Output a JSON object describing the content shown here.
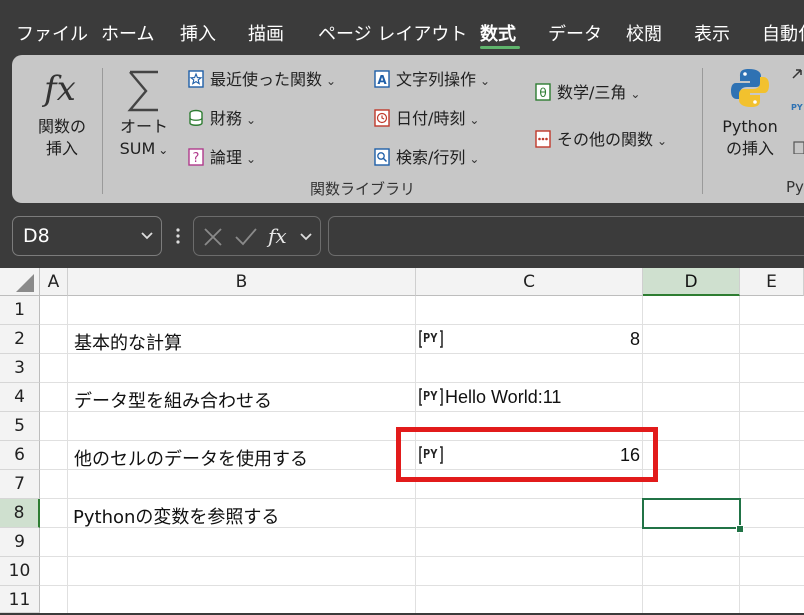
{
  "menubar": {
    "tabs": [
      {
        "label": "ファイル",
        "active": false
      },
      {
        "label": "ホーム",
        "active": false
      },
      {
        "label": "挿入",
        "active": false
      },
      {
        "label": "描画",
        "active": false
      },
      {
        "label": "ページ レイアウト",
        "active": false
      },
      {
        "label": "数式",
        "active": true
      },
      {
        "label": "データ",
        "active": false
      },
      {
        "label": "校閲",
        "active": false
      },
      {
        "label": "表示",
        "active": false
      },
      {
        "label": "自動化",
        "active": false
      }
    ]
  },
  "ribbon": {
    "insert_function": {
      "line1": "関数の",
      "line2": "挿入",
      "icon": "fx-icon"
    },
    "autosum": {
      "line1": "オート",
      "line2": "SUM",
      "icon": "sigma-icon"
    },
    "recent": {
      "label": "最近使った関数",
      "icon": "star-icon"
    },
    "financial": {
      "label": "財務",
      "icon": "database-icon"
    },
    "logical": {
      "label": "論理",
      "icon": "question-icon"
    },
    "text": {
      "label": "文字列操作",
      "icon": "text-a-icon"
    },
    "datetime": {
      "label": "日付/時刻",
      "icon": "clock-icon"
    },
    "lookup": {
      "label": "検索/行列",
      "icon": "magnifier-icon"
    },
    "math": {
      "label": "数学/三角",
      "icon": "theta-icon"
    },
    "other": {
      "label": "その他の関数",
      "icon": "dots-icon"
    },
    "group_label": "関数ライブラリ",
    "python": {
      "line1": "Python",
      "line2": "の挿入",
      "icon": "python-logo-icon"
    },
    "python_group_label": "Py"
  },
  "formula_bar": {
    "name_box": "D8",
    "formula": ""
  },
  "sheet": {
    "columns": [
      "A",
      "B",
      "C",
      "D",
      "E"
    ],
    "selected_column": "D",
    "rows": [
      "1",
      "2",
      "3",
      "4",
      "5",
      "6",
      "7",
      "8",
      "9",
      "10",
      "11"
    ],
    "selected_row": "8",
    "py_badge": "PY",
    "b2": "基本的な計算",
    "b4": "データ型を組み合わせる",
    "b6": "他のセルのデータを使用する",
    "b8": "Pythonの変数を参照する",
    "c2": "8",
    "c4": "Hello World:11",
    "c6": "16"
  },
  "colors": {
    "accent": "#217346",
    "highlight": "#e21b1b",
    "menubar_bg": "#3b3b3b",
    "ribbon_bg": "#c7c7c7"
  }
}
